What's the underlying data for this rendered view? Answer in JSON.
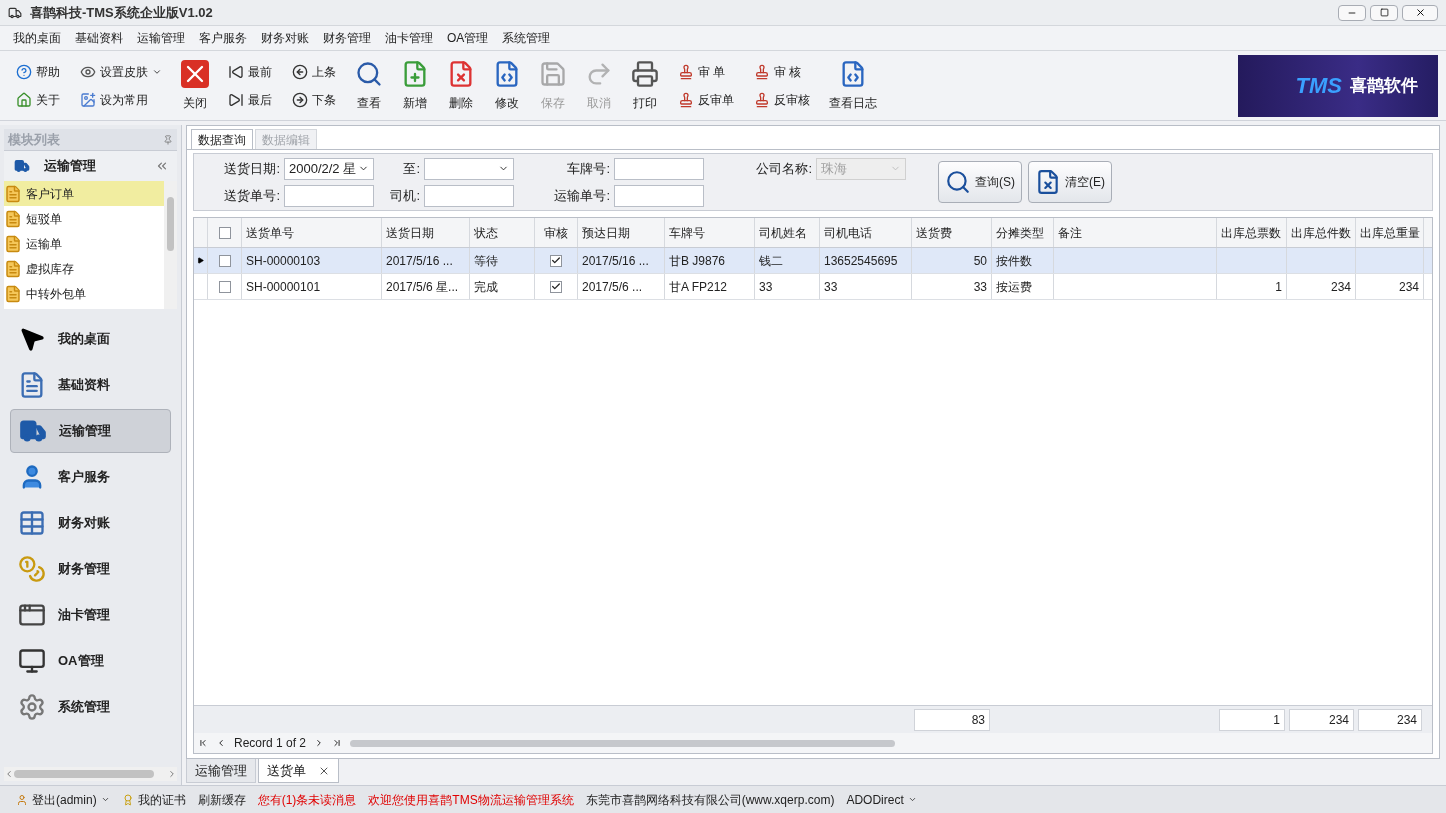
{
  "window": {
    "title": "喜鹊科技-TMS系统企业版V1.02"
  },
  "menu": [
    "我的桌面",
    "基础资料",
    "运输管理",
    "客户服务",
    "财务对账",
    "财务管理",
    "油卡管理",
    "OA管理",
    "系统管理"
  ],
  "toolbar": [
    {
      "kind": "stack",
      "items": [
        {
          "label": "帮助",
          "dropdown": false
        },
        {
          "label": "关于",
          "dropdown": false
        }
      ]
    },
    {
      "kind": "stack",
      "items": [
        {
          "label": "设置皮肤",
          "dropdown": true
        },
        {
          "label": "设为常用",
          "dropdown": false
        }
      ]
    },
    {
      "kind": "large",
      "label": "关闭",
      "disabled": false
    },
    {
      "kind": "stack",
      "items": [
        {
          "label": "最前",
          "dropdown": false
        },
        {
          "label": "最后",
          "dropdown": false
        }
      ]
    },
    {
      "kind": "stack",
      "items": [
        {
          "label": "上条",
          "dropdown": false
        },
        {
          "label": "下条",
          "dropdown": false
        }
      ]
    },
    {
      "kind": "large",
      "label": "查看",
      "disabled": false
    },
    {
      "kind": "large",
      "label": "新增",
      "disabled": false
    },
    {
      "kind": "large",
      "label": "删除",
      "disabled": false
    },
    {
      "kind": "large",
      "label": "修改",
      "disabled": false
    },
    {
      "kind": "large",
      "label": "保存",
      "disabled": true
    },
    {
      "kind": "large",
      "label": "取消",
      "disabled": true
    },
    {
      "kind": "large",
      "label": "打印",
      "disabled": false
    },
    {
      "kind": "stack",
      "items": [
        {
          "label": "审 单",
          "dropdown": false
        },
        {
          "label": "反审单",
          "dropdown": false
        }
      ]
    },
    {
      "kind": "stack",
      "items": [
        {
          "label": "审 核",
          "dropdown": false
        },
        {
          "label": "反审核",
          "dropdown": false
        }
      ]
    },
    {
      "kind": "large",
      "label": "查看日志",
      "disabled": false
    }
  ],
  "logo": {
    "mark": "TMS",
    "name": "喜鹊软件"
  },
  "sidebar": {
    "title": "模块列表",
    "module": "运输管理",
    "items": [
      {
        "label": "客户订单",
        "selected": true
      },
      {
        "label": "短驳单",
        "selected": false
      },
      {
        "label": "运输单",
        "selected": false
      },
      {
        "label": "虚拟库存",
        "selected": false
      },
      {
        "label": "中转外包单",
        "selected": false
      }
    ],
    "nav": [
      {
        "label": "我的桌面",
        "selected": false
      },
      {
        "label": "基础资料",
        "selected": false
      },
      {
        "label": "运输管理",
        "selected": true
      },
      {
        "label": "客户服务",
        "selected": false
      },
      {
        "label": "财务对账",
        "selected": false
      },
      {
        "label": "财务管理",
        "selected": false
      },
      {
        "label": "油卡管理",
        "selected": false
      },
      {
        "label": "OA管理",
        "selected": false
      },
      {
        "label": "系统管理",
        "selected": false
      }
    ]
  },
  "tabs": [
    {
      "label": "数据查询",
      "selected": true
    },
    {
      "label": "数据编辑",
      "selected": false
    }
  ],
  "filters": [
    [
      {
        "label": "送货日期:",
        "kind": "dropdown",
        "value": "2000/2/2 星",
        "disabled": false
      },
      {
        "label": "至:",
        "kind": "dropdown",
        "disabled": false
      },
      {
        "label": "车牌号:",
        "kind": "text",
        "disabled": false
      },
      {
        "label": "公司名称:",
        "kind": "dropdown",
        "value": "珠海",
        "disabled": true
      }
    ],
    [
      {
        "label": "送货单号:",
        "kind": "text",
        "disabled": false
      },
      {
        "label": "司机:",
        "kind": "text",
        "disabled": false
      },
      {
        "label": "运输单号:",
        "kind": "text",
        "disabled": false
      }
    ]
  ],
  "actions": [
    {
      "label": "查询(S)"
    },
    {
      "label": "清空(E)"
    }
  ],
  "table": {
    "select_all": false,
    "columns": [
      {
        "label": "送货单号",
        "kind": "text"
      },
      {
        "label": "送货日期",
        "kind": "text"
      },
      {
        "label": "状态",
        "kind": "text"
      },
      {
        "label": "审核",
        "kind": "check"
      },
      {
        "label": "预达日期",
        "kind": "text"
      },
      {
        "label": "车牌号",
        "kind": "text"
      },
      {
        "label": "司机姓名",
        "kind": "text"
      },
      {
        "label": "司机电话",
        "kind": "text"
      },
      {
        "label": "送货费",
        "kind": "number",
        "total": "83"
      },
      {
        "label": "分摊类型",
        "kind": "text"
      },
      {
        "label": "备注",
        "kind": "text"
      },
      {
        "label": "出库总票数",
        "kind": "number",
        "total": "1"
      },
      {
        "label": "出库总件数",
        "kind": "number",
        "total": "234"
      },
      {
        "label": "出库总重量",
        "kind": "number",
        "total": "234"
      }
    ],
    "rows": [
      {
        "selected": true,
        "checked": false,
        "cells": [
          "SH-00000103",
          "2017/5/16 ...",
          "等待",
          true,
          "2017/5/16 ...",
          "甘B J9876",
          "钱二",
          "13652545695",
          "50",
          "按件数",
          "",
          "",
          "",
          ""
        ]
      },
      {
        "selected": false,
        "checked": false,
        "cells": [
          "SH-00000101",
          "2017/5/6 星...",
          "完成",
          true,
          "2017/5/6 ...",
          "甘A FP212",
          "33",
          "33",
          "33",
          "按运费",
          "",
          "1",
          "234",
          "234"
        ]
      }
    ],
    "pager": "Record 1 of 2"
  },
  "doc_tabs": [
    {
      "label": "运输管理",
      "selected": false,
      "closable": false
    },
    {
      "label": "送货单",
      "selected": true,
      "closable": true
    }
  ],
  "status_bar": [
    {
      "label": "登出(admin)",
      "kind": "user"
    },
    {
      "label": "我的证书",
      "kind": "cert"
    },
    {
      "label": "刷新缓存",
      "kind": "plain"
    },
    {
      "label": "您有(1)条未读消息",
      "kind": "plain",
      "color": "#e00000"
    },
    {
      "label": "欢迎您使用喜鹊TMS物流运输管理系统",
      "kind": "plain",
      "color": "#e00000"
    },
    {
      "label": "东莞市喜鹊网络科技有限公司(www.xqerp.com)",
      "kind": "plain",
      "color": "#222222"
    },
    {
      "label": "ADODirect",
      "kind": "menu"
    }
  ]
}
